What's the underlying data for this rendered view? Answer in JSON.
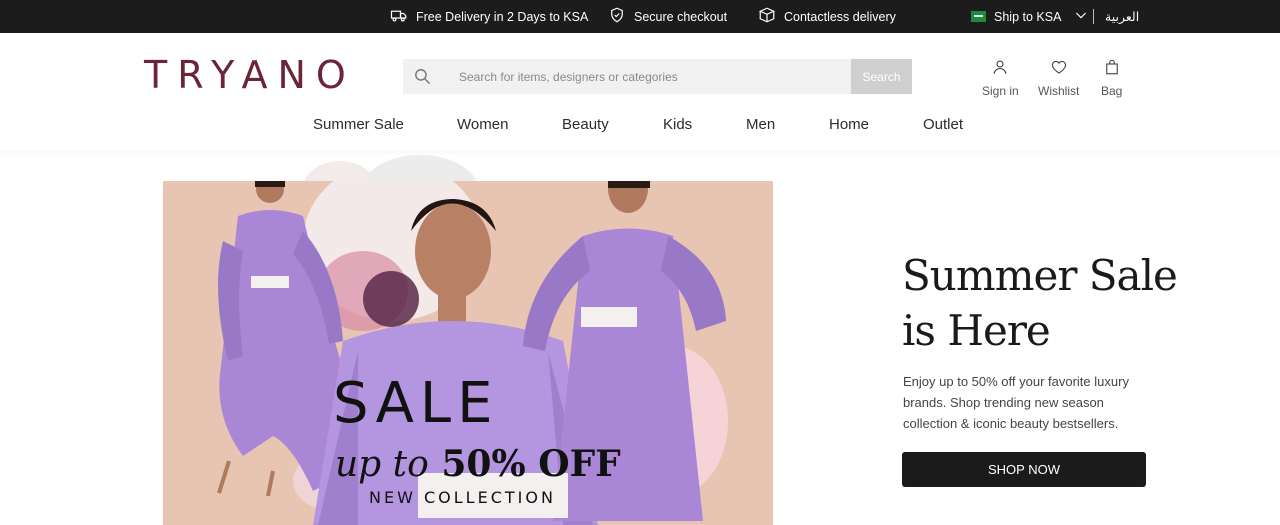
{
  "topbar": {
    "delivery": "Free Delivery in 2 Days to KSA",
    "secure": "Secure checkout",
    "contactless": "Contactless delivery",
    "ship_to": "Ship to KSA",
    "language": "العربية"
  },
  "header": {
    "logo": "TRYANO",
    "search_placeholder": "Search for items, designers or categories",
    "search_button": "Search",
    "sign_in": "Sign in",
    "wishlist": "Wishlist",
    "bag": "Bag"
  },
  "nav": [
    "Summer Sale",
    "Women",
    "Beauty",
    "Kids",
    "Men",
    "Home",
    "Outlet"
  ],
  "hero": {
    "sale": "SALE",
    "upto_prefix": "up to",
    "upto_value": "50% OFF",
    "collection": "NEW COLLECTION"
  },
  "promo": {
    "title_line1": "Summer Sale",
    "title_line2": "is Here",
    "description": "Enjoy up to 50% off your favorite luxury brands. Shop trending new season collection & iconic beauty bestsellers.",
    "cta": "SHOP NOW"
  },
  "colors": {
    "topbar_bg": "#1c1c1c",
    "brand": "#6c2437",
    "hero_bg": "#e8c4b2",
    "dress": "#a987d6",
    "cta_bg": "#1b1b1b"
  },
  "icons": [
    "truck-icon",
    "shield-icon",
    "box-icon",
    "chevron-down-icon",
    "search-icon",
    "user-icon",
    "heart-icon",
    "bag-icon"
  ]
}
